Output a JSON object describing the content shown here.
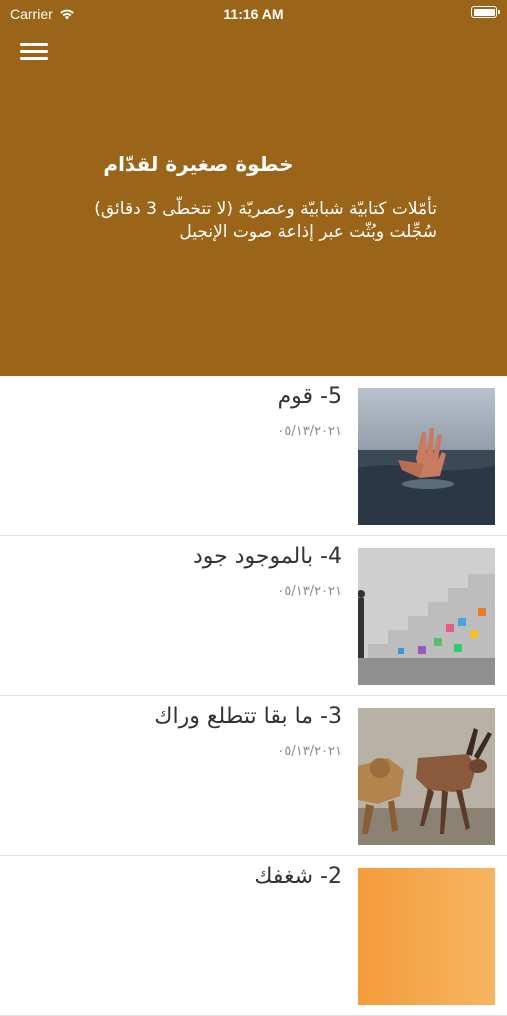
{
  "status_bar": {
    "carrier": "Carrier",
    "time": "11:16 AM"
  },
  "header": {
    "menu_icon": "hamburger-menu-icon",
    "title": "خطوة صغيرة لقدّام",
    "subtitle": "تأمّلات كتابيّة شبابيّة وعصريّة (لا تتخطّى 3 دقائق) سُجِّلت وبُثّت عبر إذاعة صوت الإنجيل",
    "background_color": "#9a6419"
  },
  "items": [
    {
      "title": "5- قوم",
      "date": "٠٥/١٣/٢٠٢١",
      "thumbnail": "hand-in-water-image"
    },
    {
      "title": "4- بالموجود جود",
      "date": "٠٥/١٣/٢٠٢١",
      "thumbnail": "stairs-wall-image"
    },
    {
      "title": "3- ما بقا تتطلع وراك",
      "date": "٠٥/١٣/٢٠٢١",
      "thumbnail": "lion-antelope-image"
    },
    {
      "title": "2- شغفك",
      "date": "",
      "thumbnail": "orange-gradient-image"
    }
  ]
}
